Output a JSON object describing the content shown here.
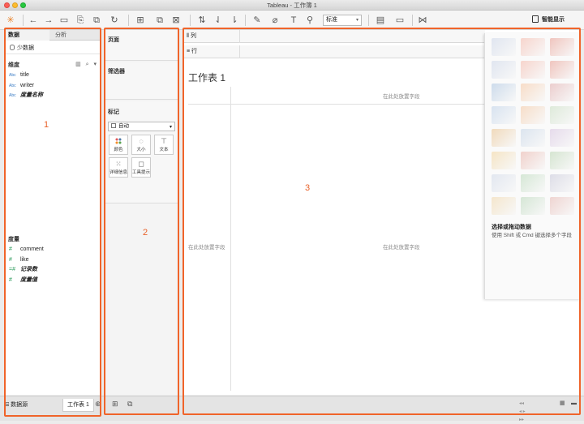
{
  "window": {
    "title": "Tableau - 工作簿 1"
  },
  "toolbar": {
    "fit_select": "标准",
    "show_me_label": "智能显示"
  },
  "data_pane": {
    "tabs": [
      "数据",
      "分析"
    ],
    "datasource": "少数据",
    "dimensions_label": "维度",
    "dimensions": [
      {
        "type": "Abc",
        "name": "title",
        "italic": false
      },
      {
        "type": "Abc",
        "name": "writer",
        "italic": false
      },
      {
        "type": "Abc",
        "name": "度量名称",
        "italic": true
      }
    ],
    "measures_label": "度量",
    "measures": [
      {
        "type": "#",
        "name": "comment",
        "italic": false
      },
      {
        "type": "#",
        "name": "like",
        "italic": false
      },
      {
        "type": "=#",
        "name": "记录数",
        "italic": true
      },
      {
        "type": "#",
        "name": "度量值",
        "italic": true
      }
    ]
  },
  "shelves": {
    "pages_label": "页面",
    "filters_label": "筛选器",
    "marks_label": "标记",
    "mark_type": "自动",
    "mark_buttons": [
      "颜色",
      "大小",
      "文本",
      "详细信息",
      "工具提示"
    ]
  },
  "view": {
    "columns_label": "列",
    "rows_label": "行",
    "sheet_title": "工作表 1",
    "drop_field_hint": "在此处放置字段"
  },
  "show_me": {
    "title": "选择或拖动数据",
    "description": "使用 Shift 或 Cmd 键选择多个字段"
  },
  "bottom_tabs": {
    "datasource": "数据源",
    "sheet": "工作表 1"
  },
  "annotations": [
    "1",
    "2",
    "3"
  ],
  "colors": {
    "annotation": "#f0642a",
    "dimension": "#3c7ec6",
    "measure": "#2a9a5a"
  }
}
